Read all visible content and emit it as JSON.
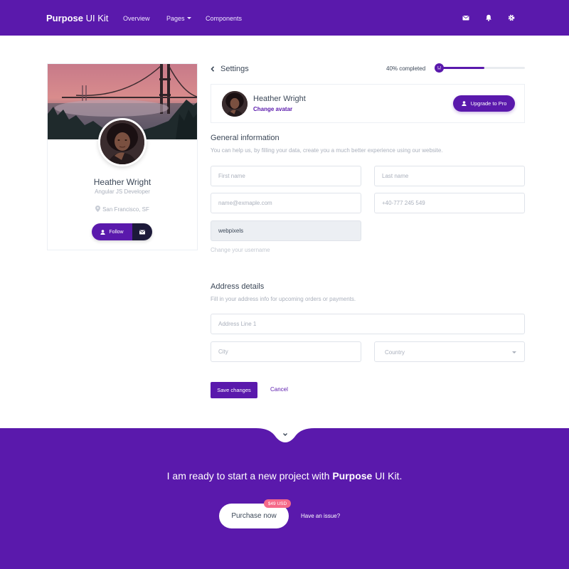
{
  "colors": {
    "primary": "#5a19ac",
    "dark": "#1d1a3a",
    "badge": "#f56a8a",
    "muted": "#aab0bc"
  },
  "navbar": {
    "brand_bold": "Purpose",
    "brand_rest": " UI Kit",
    "links": [
      "Overview",
      "Pages",
      "Components"
    ],
    "icons": [
      "mail-icon",
      "bell-icon",
      "gear-icon"
    ]
  },
  "profile": {
    "name": "Heather Wright",
    "role": "Angular JS Developer",
    "location": "San Francisco, SF",
    "follow_label": "Follow"
  },
  "settings": {
    "title": "Settings",
    "progress_label": "40% completed",
    "progress_fraction": 0.4
  },
  "user_card": {
    "name": "Heather Wright",
    "change_avatar": "Change avatar",
    "upgrade_label": "Upgrade to Pro"
  },
  "general": {
    "title": "General information",
    "subtitle": "You can help us, by filling your data, create you a much better experience using our website.",
    "first_name_placeholder": "First name",
    "last_name_placeholder": "Last name",
    "email_placeholder": "name@exmaple.com",
    "phone_placeholder": "+40-777 245 549",
    "username_value": "webpixels",
    "username_helper": "Change your username"
  },
  "address": {
    "title": "Address details",
    "subtitle": "Fill in your address info for upcoming orders or payments.",
    "line1_placeholder": "Address Line 1",
    "city_placeholder": "City",
    "country_placeholder": "Country"
  },
  "actions": {
    "save_label": "Save changes",
    "cancel_label": "Cancel"
  },
  "footer": {
    "cta_prefix": "I am ready to start a new project with ",
    "cta_brand": "Purpose",
    "cta_suffix": " UI Kit.",
    "purchase_label": "Purchase now",
    "price_badge": "$49 USD",
    "issue_link": "Have an issue?"
  }
}
